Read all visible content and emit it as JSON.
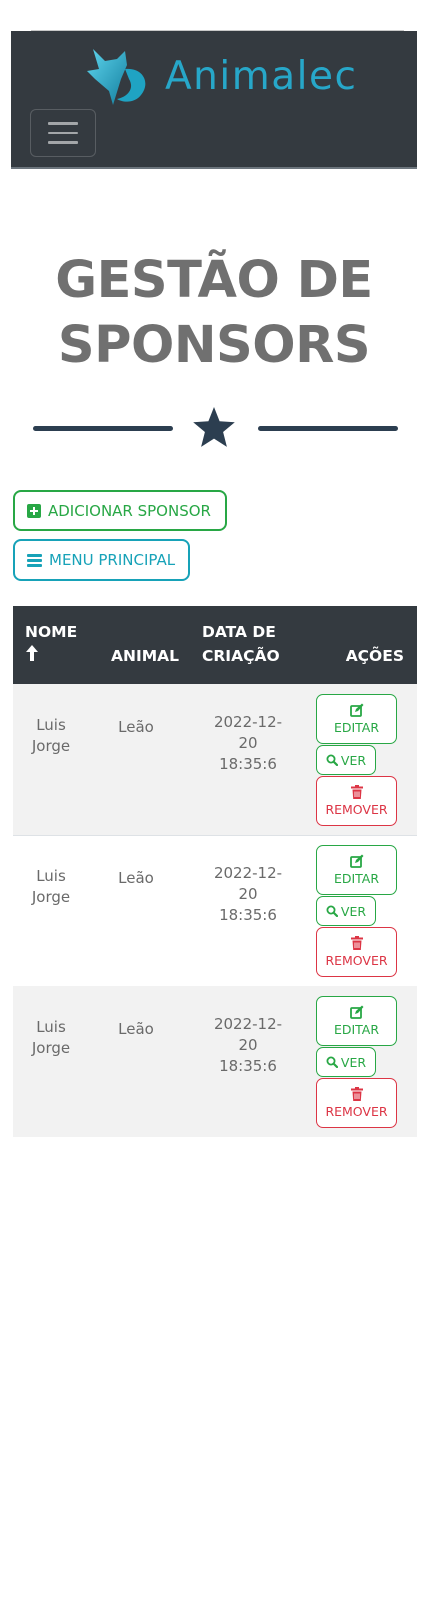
{
  "navbar": {
    "brand": "Animalec",
    "brand_color": "#27a7c9",
    "toggler_icon": "hamburger-icon"
  },
  "page": {
    "title": "GESTÃO DE SPONSORS",
    "title_line1": "GESTÃO DE",
    "title_line2": "SPONSORS",
    "divider_icon": "star-icon",
    "divider_color": "#2c3e50"
  },
  "actions": {
    "add_label": "ADICIONAR SPONSOR",
    "add_icon": "plus-square-icon",
    "menu_label": "MENU PRINCIPAL",
    "menu_icon": "bars-icon"
  },
  "table": {
    "headers": {
      "nome": "NOME",
      "animal": "ANIMAL",
      "data_line1": "DATA DE",
      "data_line2": "CRIAÇÃO",
      "acoes": "AÇÕES"
    },
    "sort_icon": "arrow-up-icon",
    "rows": [
      {
        "nome": "Luis Jorge",
        "animal": "Leão",
        "data_line1": "2022-12-",
        "data_line2": "20",
        "data_line3": "18:35:6",
        "edit": "EDITAR",
        "ver": "VER",
        "remove": "REMOVER"
      },
      {
        "nome": "Luis Jorge",
        "animal": "Leão",
        "data_line1": "2022-12-",
        "data_line2": "20",
        "data_line3": "18:35:6",
        "edit": "EDITAR",
        "ver": "VER",
        "remove": "REMOVER"
      },
      {
        "nome": "Luis Jorge",
        "animal": "Leão",
        "data_line1": "2022-12-",
        "data_line2": "20",
        "data_line3": "18:35:6",
        "edit": "EDITAR",
        "ver": "VER",
        "remove": "REMOVER"
      }
    ]
  },
  "colors": {
    "success": "#28a745",
    "info": "#17a2b8",
    "danger": "#dc3545",
    "dark": "#343a40"
  }
}
